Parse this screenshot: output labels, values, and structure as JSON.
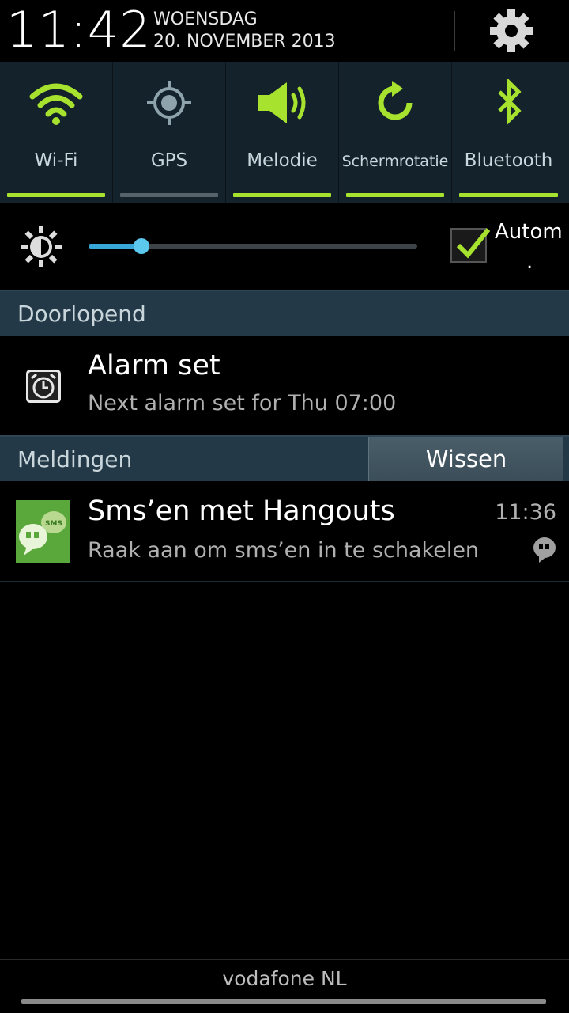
{
  "status": {
    "time": "11:42",
    "day": "WOENSDAG",
    "date": "20. NOVEMBER 2013"
  },
  "quick_settings": {
    "toggles": [
      {
        "label": "Wi-Fi",
        "icon": "wifi-icon",
        "state": "on"
      },
      {
        "label": "GPS",
        "icon": "gps-icon",
        "state": "off"
      },
      {
        "label": "Melodie",
        "icon": "sound-icon",
        "state": "on"
      },
      {
        "label": "Schermrotatie",
        "icon": "rotation-icon",
        "state": "on"
      },
      {
        "label": "Bluetooth",
        "icon": "bluetooth-icon",
        "state": "on"
      }
    ],
    "accent_color": "#a6e22e"
  },
  "brightness": {
    "level": 0.16,
    "auto_label": "Autom",
    "auto_suffix": ".",
    "auto_checked": true
  },
  "ongoing": {
    "header": "Doorlopend",
    "items": [
      {
        "title": "Alarm set",
        "text": "Next alarm set for Thu 07:00",
        "icon": "alarm-clock-icon"
      }
    ]
  },
  "notifications": {
    "header": "Meldingen",
    "clear_label": "Wissen",
    "items": [
      {
        "title": "Sms’en met Hangouts",
        "text": "Raak aan om sms’en in te schakelen",
        "time": "11:36",
        "icon": "hangouts-sms-icon",
        "app_icon_text": "SMS"
      }
    ]
  },
  "carrier": "vodafone NL"
}
